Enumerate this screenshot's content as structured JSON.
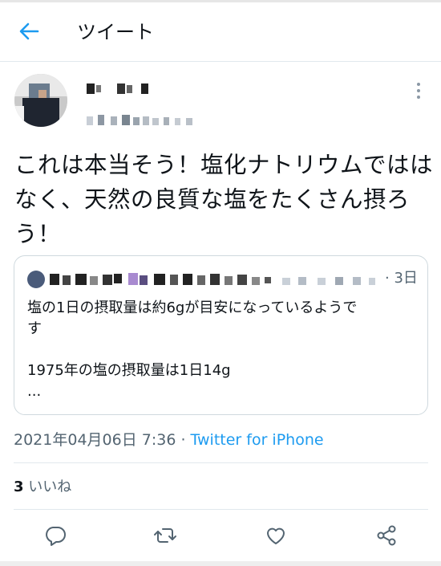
{
  "header": {
    "title": "ツイート"
  },
  "tweet": {
    "text_lines": [
      "これは本当そう！塩化ナトリウムではは",
      "なく、天然の良質な塩をたくさん摂ろ",
      "う！"
    ]
  },
  "quote": {
    "time": "· 3日",
    "lines": [
      "塩の1日の摂取量は約6gが目安になっているようで",
      "す",
      "",
      "1975年の塩の摂取量は1日14g",
      "..."
    ]
  },
  "meta": {
    "datetime": "2021年04月06日 7:36",
    "separator": " · ",
    "source": "Twitter for iPhone"
  },
  "stats": {
    "like_count": "3",
    "like_label": " いいね"
  },
  "colors": {
    "accent": "#1d9bf0",
    "muted": "#536471",
    "text": "#0f1419"
  }
}
